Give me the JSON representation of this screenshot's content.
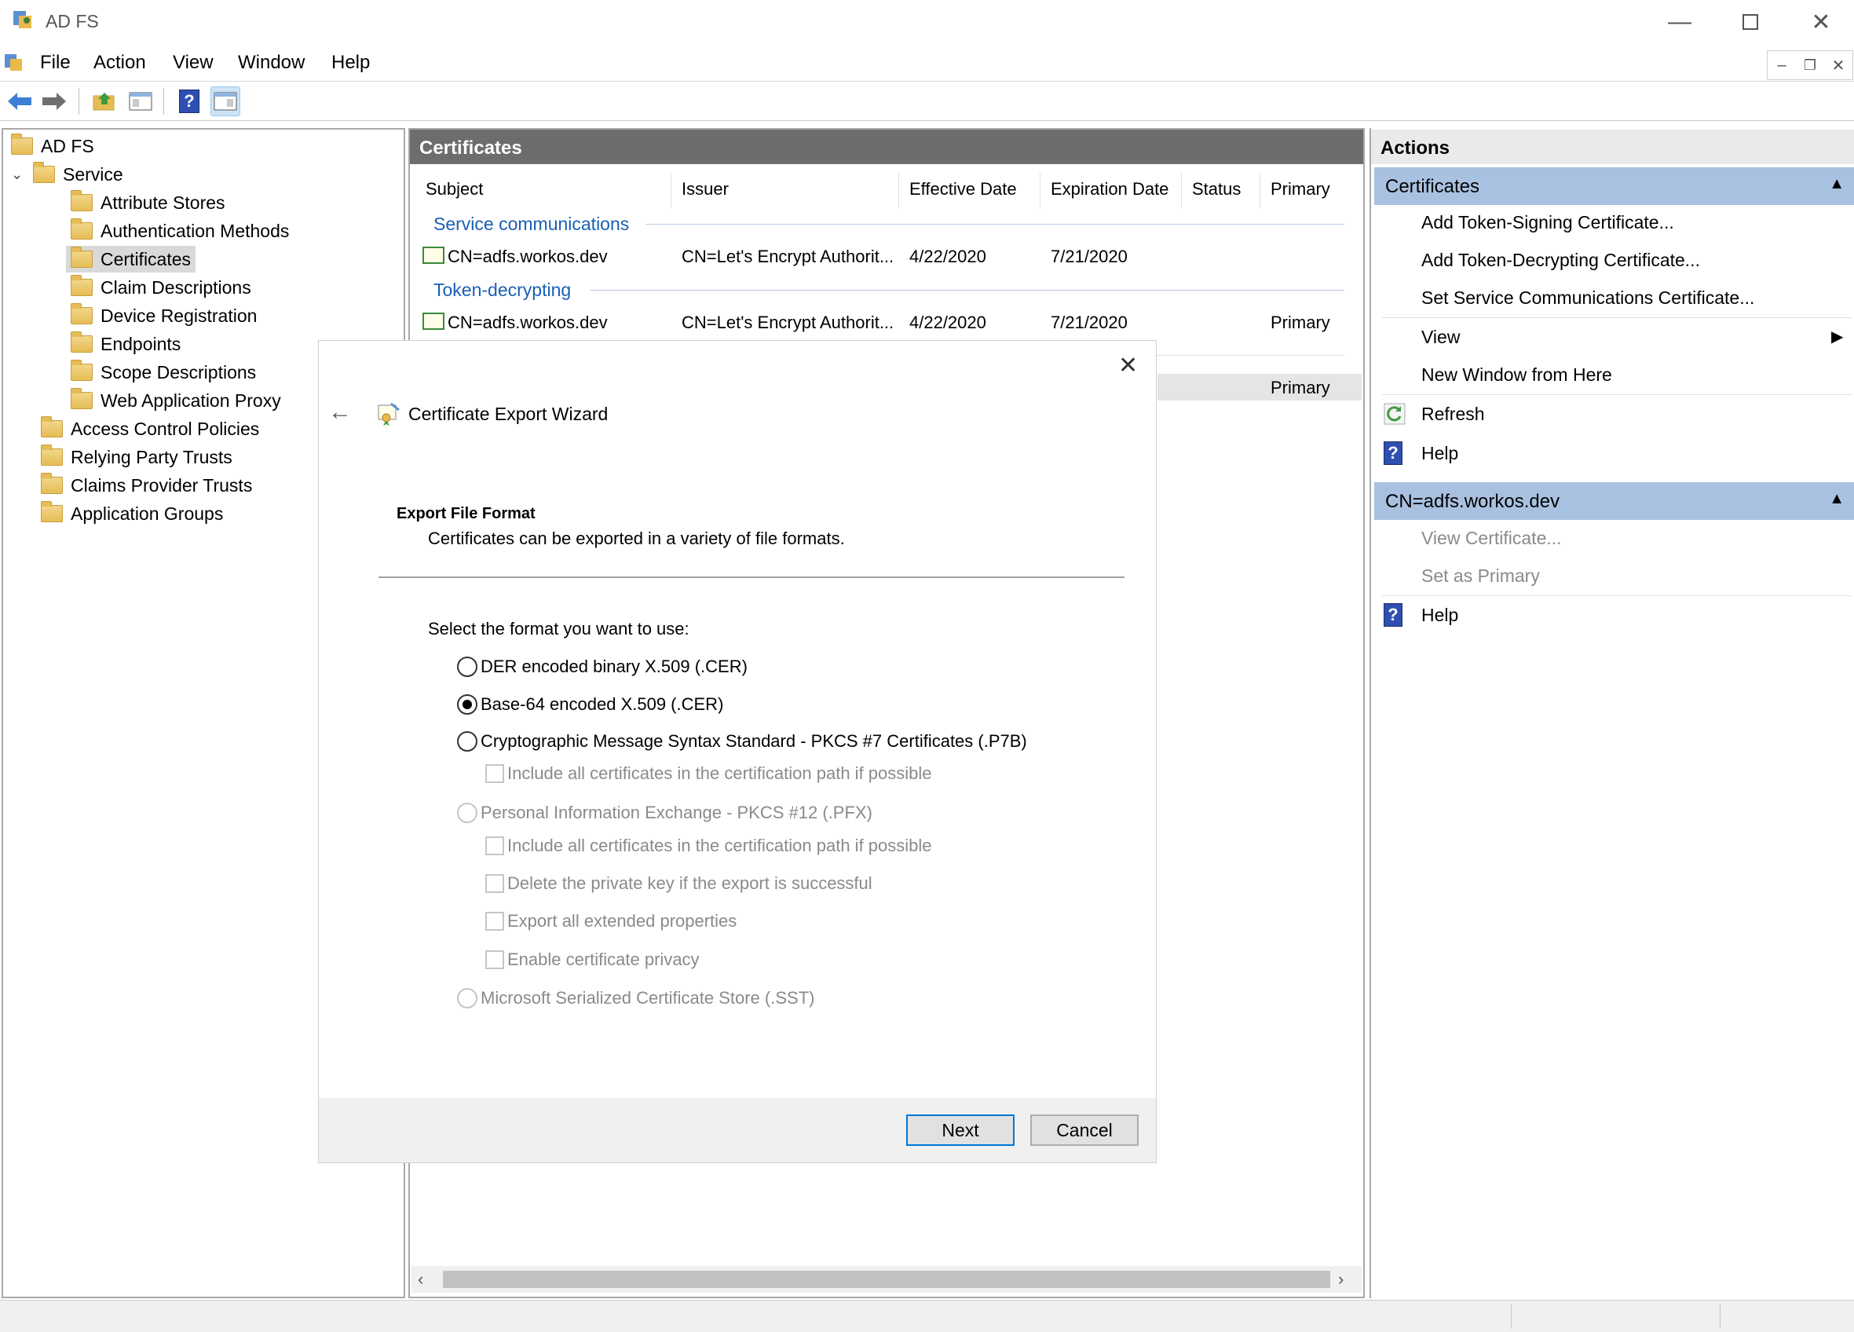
{
  "window": {
    "title": "AD FS"
  },
  "menu": [
    "File",
    "Action",
    "View",
    "Window",
    "Help"
  ],
  "tree": {
    "root": "AD FS",
    "service": "Service",
    "service_children": [
      "Attribute Stores",
      "Authentication Methods",
      "Certificates",
      "Claim Descriptions",
      "Device Registration",
      "Endpoints",
      "Scope Descriptions",
      "Web Application Proxy"
    ],
    "top_items": [
      "Access Control Policies",
      "Relying Party Trusts",
      "Claims Provider Trusts",
      "Application Groups"
    ]
  },
  "center": {
    "header": "Certificates",
    "columns": [
      "Subject",
      "Issuer",
      "Effective Date",
      "Expiration Date",
      "Status",
      "Primary"
    ],
    "groups": [
      {
        "name": "Service communications",
        "rows": [
          {
            "subject": "CN=adfs.workos.dev",
            "issuer": "CN=Let's Encrypt Authorit...",
            "effective": "4/22/2020",
            "expiration": "7/21/2020",
            "status": "",
            "primary": ""
          }
        ]
      },
      {
        "name": "Token-decrypting",
        "rows": [
          {
            "subject": "CN=adfs.workos.dev",
            "issuer": "CN=Let's Encrypt Authorit...",
            "effective": "4/22/2020",
            "expiration": "7/21/2020",
            "status": "",
            "primary": "Primary"
          }
        ]
      }
    ],
    "partial_primary": "Primary"
  },
  "actions": {
    "title": "Actions",
    "section1": "Certificates",
    "items1": [
      "Add Token-Signing Certificate...",
      "Add Token-Decrypting Certificate...",
      "Set Service Communications Certificate...",
      "View",
      "New Window from Here",
      "Refresh",
      "Help"
    ],
    "section2": "CN=adfs.workos.dev",
    "items2": [
      "View Certificate...",
      "Set as Primary",
      "Help"
    ]
  },
  "wizard": {
    "title": "Certificate Export Wizard",
    "heading": "Export File Format",
    "subheading": "Certificates can be exported in a variety of file formats.",
    "prompt": "Select the format you want to use:",
    "options": {
      "der": "DER encoded binary X.509 (.CER)",
      "base64": "Base-64 encoded X.509 (.CER)",
      "pkcs7": "Cryptographic Message Syntax Standard - PKCS #7 Certificates (.P7B)",
      "pkcs7_include": "Include all certificates in the certification path if possible",
      "pfx": "Personal Information Exchange - PKCS #12 (.PFX)",
      "pfx_include": "Include all certificates in the certification path if possible",
      "pfx_delete": "Delete the private key if the export is successful",
      "pfx_export_props": "Export all extended properties",
      "pfx_privacy": "Enable certificate privacy",
      "sst": "Microsoft Serialized Certificate Store (.SST)"
    },
    "selected": "base64",
    "next": "Next",
    "cancel": "Cancel"
  }
}
